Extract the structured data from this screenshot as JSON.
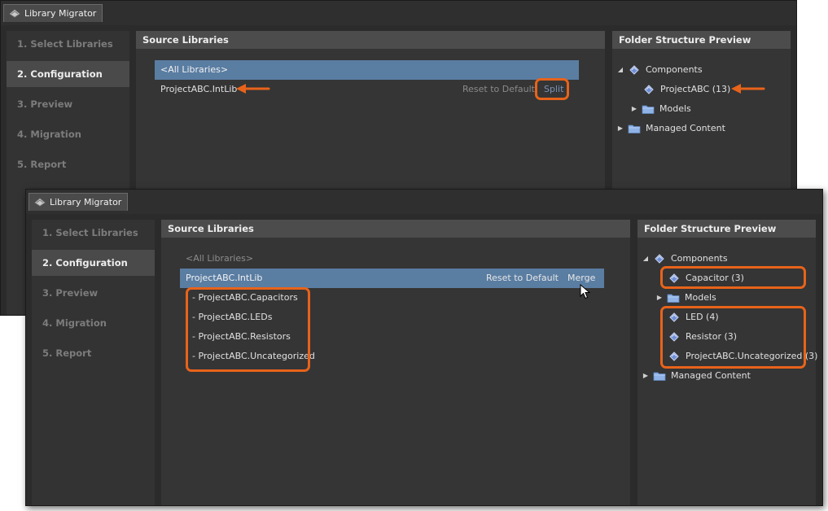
{
  "window_title": "Library Migrator",
  "steps": [
    "1. Select Libraries",
    "2. Configuration",
    "3. Preview",
    "4. Migration",
    "5. Report"
  ],
  "active_step_index": 1,
  "source_libraries": {
    "header": "Source Libraries",
    "all_libraries": "<All Libraries>",
    "library": "ProjectABC.IntLib",
    "reset_label": "Reset to Default",
    "split_label": "Split",
    "merge_label": "Merge",
    "split_items": [
      "- ProjectABC.Capacitors",
      "- ProjectABC.LEDs",
      "- ProjectABC.Resistors",
      "- ProjectABC.Uncategorized"
    ]
  },
  "folder_preview": {
    "header": "Folder Structure Preview",
    "components_label": "Components",
    "models_label": "Models",
    "managed_label": "Managed Content",
    "before_items": [
      "ProjectABC (13)"
    ],
    "after_items": [
      "Capacitor (3)",
      "LED (4)",
      "Resistor (3)",
      "ProjectABC.Uncategorized (3)"
    ]
  },
  "colors": {
    "highlight": "#e8631a",
    "selection": "#5a7da2",
    "component_icon": "#6f8fd6",
    "folder_icon": "#8fb3e6"
  }
}
